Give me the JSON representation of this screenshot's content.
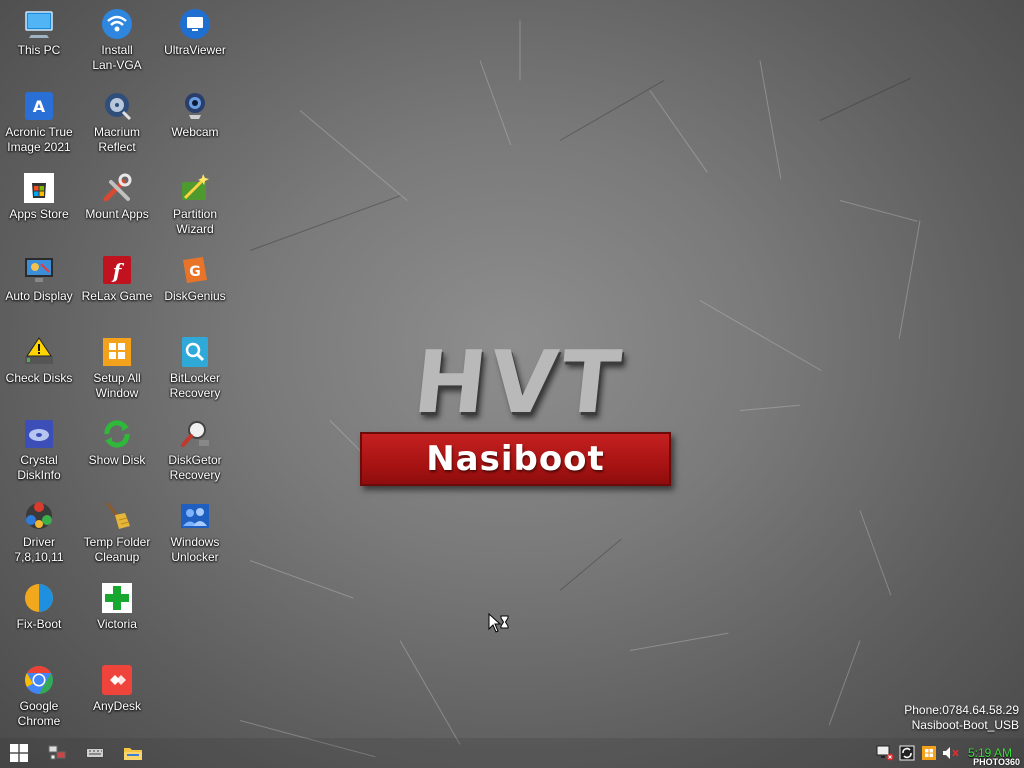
{
  "desktop": {
    "icons": [
      {
        "label": "This PC",
        "icon": "computer-icon"
      },
      {
        "label": "Install\nLan-VGA",
        "icon": "wifi-icon"
      },
      {
        "label": "UltraViewer",
        "icon": "monitor-icon"
      },
      {
        "label": "Acronic True\nImage 2021",
        "icon": "acronis-icon"
      },
      {
        "label": "Macrium\nReflect",
        "icon": "disk-backup-icon"
      },
      {
        "label": "Webcam",
        "icon": "webcam-icon"
      },
      {
        "label": "Apps Store",
        "icon": "store-icon"
      },
      {
        "label": "Mount Apps",
        "icon": "tools-icon"
      },
      {
        "label": "Partition\nWizard",
        "icon": "wand-icon"
      },
      {
        "label": "Auto Display",
        "icon": "display-paint-icon"
      },
      {
        "label": "ReLax Game",
        "icon": "flash-icon"
      },
      {
        "label": "DiskGenius",
        "icon": "diskgenius-icon"
      },
      {
        "label": "Check Disks",
        "icon": "warning-drive-icon"
      },
      {
        "label": "Setup All\nWindow",
        "icon": "windows-setup-icon"
      },
      {
        "label": "BitLocker\nRecovery",
        "icon": "bitlocker-icon"
      },
      {
        "label": "Crystal\nDiskInfo",
        "icon": "crystal-disk-icon"
      },
      {
        "label": "Show Disk",
        "icon": "refresh-green-icon"
      },
      {
        "label": "DiskGetor\nRecovery",
        "icon": "magnifier-icon"
      },
      {
        "label": "Driver\n7,8,10,11",
        "icon": "driver-icon"
      },
      {
        "label": "Temp Folder\nCleanup",
        "icon": "broom-icon"
      },
      {
        "label": "Windows\nUnlocker",
        "icon": "users-icon"
      },
      {
        "label": "Fix-Boot",
        "icon": "pie-icon"
      },
      {
        "label": "Victoria",
        "icon": "green-cross-icon"
      },
      {
        "label": "Google\nChrome",
        "icon": "chrome-icon"
      },
      {
        "label": "AnyDesk",
        "icon": "anydesk-icon"
      }
    ]
  },
  "logo": {
    "title": "HVT",
    "banner": "Nasiboot"
  },
  "info": {
    "phone": "Phone:0784.64.58.29",
    "name": "Nasiboot-Boot_USB"
  },
  "taskbar": {
    "clock": "5:19 AM",
    "watermark": "PHOTO360"
  },
  "colors": {
    "banner_red": "#b51717",
    "clock_green": "#3cdc3c",
    "background_gray": "#7a7a7a"
  }
}
